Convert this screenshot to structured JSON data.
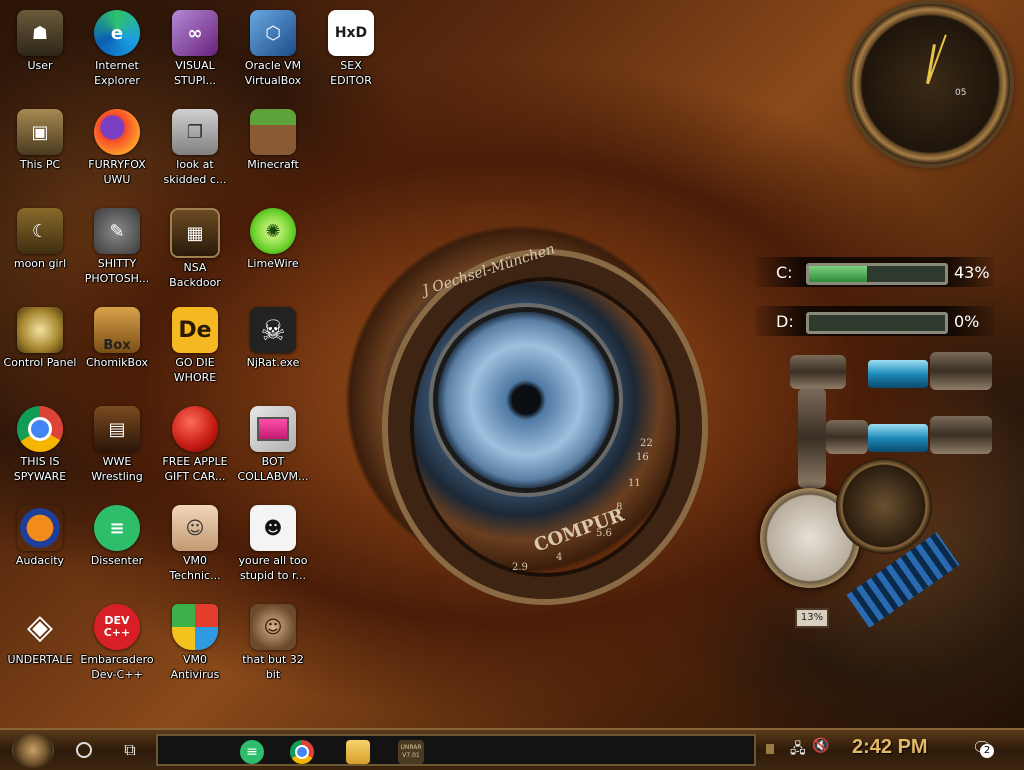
{
  "desktop": {
    "icons": [
      {
        "label": "User"
      },
      {
        "label": "Internet\nExplorer"
      },
      {
        "label": "VISUAL\nSTUPI..."
      },
      {
        "label": "Oracle VM\nVirtualBox"
      },
      {
        "label": "SEX\nEDITOR"
      },
      {
        "label": "This PC"
      },
      {
        "label": "FURRYFOX\nUWU"
      },
      {
        "label": "look at\nskidded c..."
      },
      {
        "label": "Minecraft"
      },
      {
        "label": "moon girl"
      },
      {
        "label": "SHITTY\nPHOTOSH..."
      },
      {
        "label": "NSA\nBackdoor"
      },
      {
        "label": "LimeWire"
      },
      {
        "label": "Control Panel"
      },
      {
        "label": "ChomikBox"
      },
      {
        "label": "GO DIE\nWHORE"
      },
      {
        "label": "NjRat.exe"
      },
      {
        "label": "THIS IS\nSPYWARE"
      },
      {
        "label": "WWE\nWrestling"
      },
      {
        "label": "FREE APPLE\nGIFT CAR..."
      },
      {
        "label": "BOT\nCOLLABVM..."
      },
      {
        "label": "Audacity"
      },
      {
        "label": "Dissenter"
      },
      {
        "label": "VM0\nTechnic..."
      },
      {
        "label": "youre all too\nstupid to r..."
      },
      {
        "label": "UNDERTALE"
      },
      {
        "label": "Embarcadero\nDev-C++"
      },
      {
        "label": "VM0\nAntivirus"
      },
      {
        "label": "that but 32\nbit"
      }
    ],
    "glyphs": {
      "dev": "DEV\nC++",
      "de": "De",
      "box": "Box",
      "hxd": "HxD"
    }
  },
  "wallpaper": {
    "eye_brand": "J Oechsel-München",
    "eye_bottom": "COMPUR",
    "scale": [
      "2.9",
      "4",
      "5.6",
      "8",
      "11",
      "16",
      "22"
    ]
  },
  "clock_widget": {
    "subdial": "05"
  },
  "drives": [
    {
      "letter": "C:",
      "percent_text": "43%",
      "fill": 0.43
    },
    {
      "letter": "D:",
      "percent_text": "0%",
      "fill": 0.0
    }
  ],
  "pressure_dial": {
    "label": "13%"
  },
  "taskbar": {
    "time": "2:42 PM",
    "notification_count": "2",
    "thumb_label": "UNRAR\nV7.01"
  },
  "colors": {
    "accent_gold": "#e3b866",
    "gauge_green": "#2f8a3a"
  }
}
